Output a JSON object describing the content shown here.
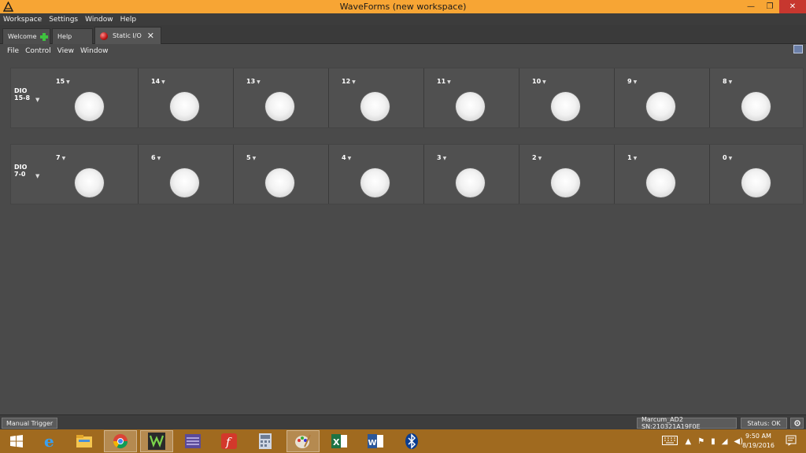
{
  "window": {
    "title": "WaveForms  (new workspace)",
    "minimize": "—",
    "maximize": "❐",
    "close": "✕"
  },
  "main_menu": [
    "Workspace",
    "Settings",
    "Window",
    "Help"
  ],
  "tabs": [
    {
      "label": "Welcome"
    },
    {
      "label": "Help"
    },
    {
      "label": "Static I/O"
    }
  ],
  "instrument_menu": [
    "File",
    "Control",
    "View",
    "Window"
  ],
  "dio_groups": [
    {
      "label_line1": "DIO",
      "label_line2": "15-8",
      "pins": [
        "15",
        "14",
        "13",
        "12",
        "11",
        "10",
        "9",
        "8"
      ]
    },
    {
      "label_line1": "DIO",
      "label_line2": "7-0",
      "pins": [
        "7",
        "6",
        "5",
        "4",
        "3",
        "2",
        "1",
        "0"
      ]
    }
  ],
  "status_bar": {
    "trigger_button": "Manual Trigger",
    "device": "Marcum_AD2 SN:210321A19F0E",
    "status": "Status: OK"
  },
  "taskbar": {
    "time": "9:50 AM",
    "date": "8/19/2016",
    "apps": [
      "windows-start-icon",
      "internet-explorer-icon",
      "file-explorer-icon",
      "chrome-icon",
      "waveforms-icon",
      "waveforms-sdk-icon",
      "foxit-reader-icon",
      "calculator-icon",
      "paint-icon",
      "excel-icon",
      "word-icon",
      "bluetooth-icon"
    ]
  },
  "colors": {
    "title_bar": "#f7a534",
    "panel_bg": "#4a4a4a",
    "led_off": "#f2f2f2",
    "taskbar": "#a06a1f",
    "close_button": "#c7372f"
  }
}
